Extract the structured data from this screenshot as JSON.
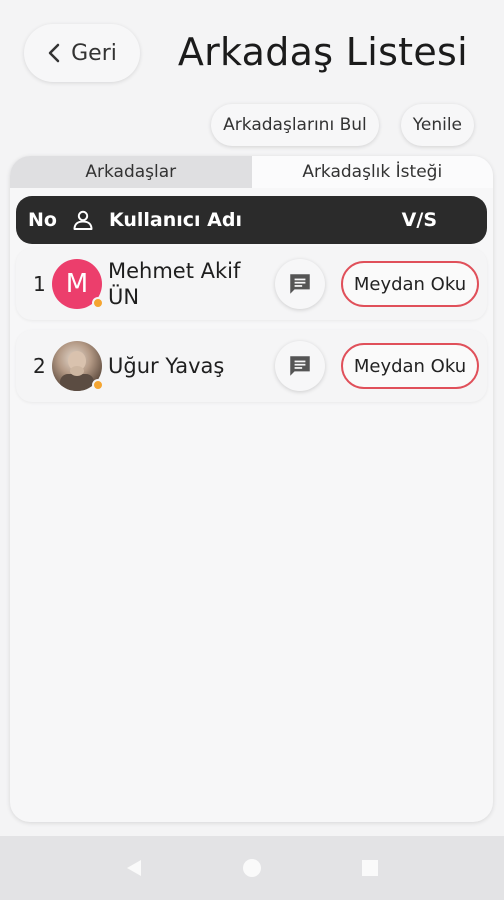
{
  "header": {
    "back_label": "Geri",
    "title": "Arkadaş Listesi"
  },
  "actions": {
    "find_friends": "Arkadaşlarını Bul",
    "refresh": "Yenile"
  },
  "tabs": [
    {
      "label": "Arkadaşlar",
      "active": true
    },
    {
      "label": "Arkadaşlık İsteği",
      "active": false
    }
  ],
  "table": {
    "col_no": "No",
    "col_username": "Kullanıcı Adı",
    "col_vs": "V/S"
  },
  "friends": [
    {
      "no": "1",
      "avatar_letter": "M",
      "name": "Mehmet Akif ÜN",
      "challenge_label": "Meydan Oku"
    },
    {
      "no": "2",
      "avatar_letter": "",
      "name": "Uğur Yavaş",
      "challenge_label": "Meydan Oku"
    }
  ],
  "colors": {
    "accent_red": "#e0505a",
    "avatar_pink": "#ec3e6c",
    "status_orange": "#f5a531",
    "header_dark": "#2b2b2b"
  },
  "icons": {
    "back": "chevron-left-icon",
    "user": "user-icon",
    "chat": "chat-icon",
    "nav_back": "triangle-back-icon",
    "nav_home": "circle-home-icon",
    "nav_recent": "square-recent-icon"
  }
}
